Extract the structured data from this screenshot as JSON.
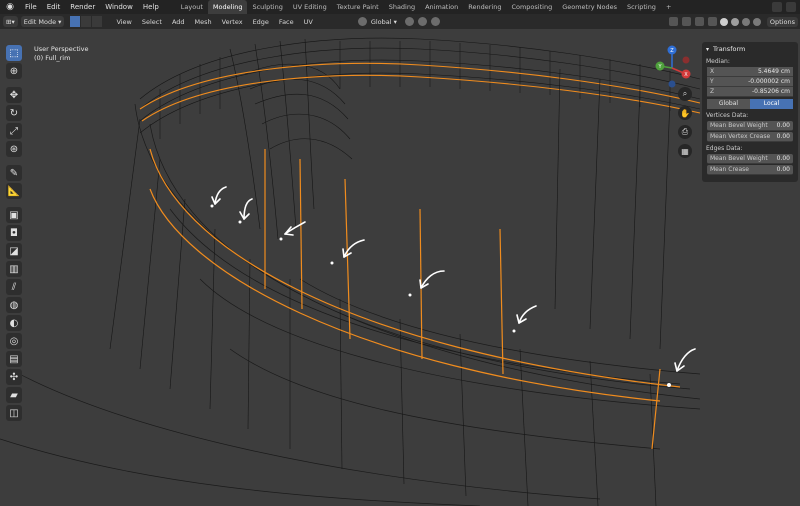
{
  "topbar": {
    "menu": [
      "File",
      "Edit",
      "Render",
      "Window",
      "Help"
    ],
    "workspaces": [
      "Layout",
      "Modeling",
      "Sculpting",
      "UV Editing",
      "Texture Paint",
      "Shading",
      "Animation",
      "Rendering",
      "Compositing",
      "Geometry Nodes",
      "Scripting"
    ],
    "active_workspace": "Modeling",
    "add_tab": "+"
  },
  "header": {
    "mode": "Edit Mode",
    "menus": [
      "View",
      "Select",
      "Add",
      "Mesh",
      "Vertex",
      "Edge",
      "Face",
      "UV"
    ],
    "orientation": "Global",
    "options": "Options"
  },
  "viewport": {
    "perspective": "User Perspective",
    "object": "(0) Full_rim",
    "background": "#3d3d3d",
    "selection_color": "#f08c1e"
  },
  "toolbar": {
    "tools": [
      "select-box-icon",
      "cursor-icon",
      "move-icon",
      "rotate-icon",
      "scale-icon",
      "transform-icon",
      "annotate-icon",
      "measure-icon",
      "extrude-icon",
      "inset-icon",
      "bevel-icon",
      "loop-cut-icon",
      "knife-icon",
      "poly-build-icon",
      "spin-icon",
      "smooth-icon",
      "edge-slide-icon",
      "shrink-icon",
      "shear-icon",
      "rip-icon"
    ]
  },
  "gizmo": {
    "x": "X",
    "y": "Y",
    "z": "Z"
  },
  "npanel": {
    "title": "Transform",
    "median_label": "Median:",
    "x_label": "X",
    "x_value": "5.4649 cm",
    "y_label": "Y",
    "y_value": "-0.000002 cm",
    "z_label": "Z",
    "z_value": "-0.85206 cm",
    "global": "Global",
    "local": "Local",
    "vertices_data": "Vertices Data:",
    "mean_bevel_weight_label": "Mean Bevel Weight",
    "mean_bevel_weight_value": "0.00",
    "mean_vertex_crease_label": "Mean Vertex Crease",
    "mean_vertex_crease_value": "0.00",
    "edges_data": "Edges Data:",
    "edge_mean_bevel_weight_label": "Mean Bevel Weight",
    "edge_mean_bevel_weight_value": "0.00",
    "mean_crease_label": "Mean Crease",
    "mean_crease_value": "0.00"
  }
}
